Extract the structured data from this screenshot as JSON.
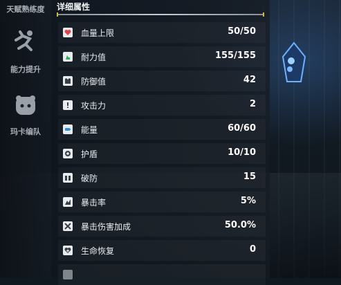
{
  "sidebar": {
    "top_label": "天赋熟练度",
    "items": [
      {
        "label": "能力提升",
        "icon": "running-figure-icon"
      },
      {
        "label": "玛卡编队",
        "icon": "team-face-icon"
      }
    ]
  },
  "panel": {
    "title": "详细属性",
    "stats": [
      {
        "name": "血量上限",
        "value": "50/50",
        "icon": "heart-icon",
        "icon_color": "#e0434b"
      },
      {
        "name": "耐力值",
        "value": "155/155",
        "icon": "stamina-icon",
        "icon_color": "#2fae55"
      },
      {
        "name": "防御值",
        "value": "42",
        "icon": "armor-icon",
        "icon_color": "#3a3f46"
      },
      {
        "name": "攻击力",
        "value": "2",
        "icon": "attack-icon",
        "icon_color": "#3a3f46"
      },
      {
        "name": "能量",
        "value": "60/60",
        "icon": "battery-icon",
        "icon_color": "#2f8fe0"
      },
      {
        "name": "护盾",
        "value": "10/10",
        "icon": "shield-icon",
        "icon_color": "#3a3f46"
      },
      {
        "name": "破防",
        "value": "15",
        "icon": "armor-break-icon",
        "icon_color": "#3a3f46"
      },
      {
        "name": "暴击率",
        "value": "5%",
        "icon": "crit-rate-icon",
        "icon_color": "#3a3f46"
      },
      {
        "name": "暴击伤害加成",
        "value": "50.0%",
        "icon": "crit-damage-icon",
        "icon_color": "#3a3f46"
      },
      {
        "name": "生命恢复",
        "value": "0",
        "icon": "regen-icon",
        "icon_color": "#3a3f46"
      }
    ]
  }
}
